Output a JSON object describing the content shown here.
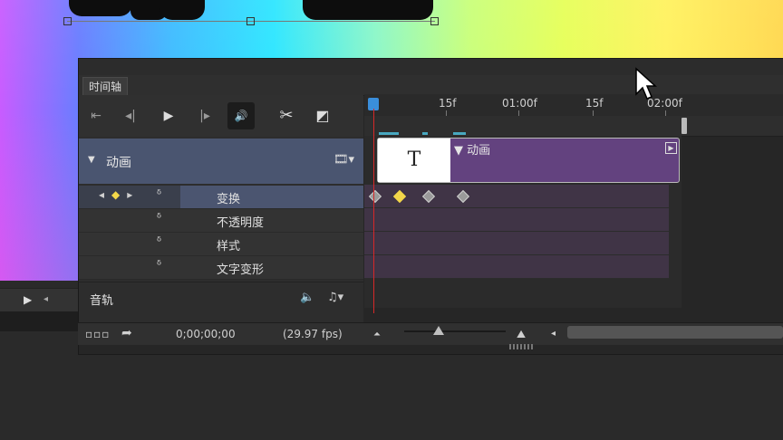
{
  "panel": {
    "tab_label": "时间轴"
  },
  "ruler": {
    "ticks": [
      "15f",
      "01:00f",
      "15f",
      "02:00f"
    ]
  },
  "track": {
    "name": "动画",
    "clip_name": "动画",
    "thumb_letter": "T"
  },
  "properties": [
    {
      "label": "变换"
    },
    {
      "label": "不透明度"
    },
    {
      "label": "样式"
    },
    {
      "label": "文字变形"
    }
  ],
  "audio": {
    "name": "音轨"
  },
  "status": {
    "timecode": "0;00;00;00",
    "fps": "(29.97 fps)"
  },
  "icons": {
    "go_start": "⇤",
    "prev_frame": "◂|",
    "play": "▶",
    "next_frame": "|▸",
    "speaker": "🔊",
    "scissors": "✂",
    "split": "◩"
  },
  "colors": {
    "clip": "#63427f",
    "playhead": "#d62828",
    "keyframe_active": "#f2d64a",
    "track_header": "#4a5570"
  }
}
